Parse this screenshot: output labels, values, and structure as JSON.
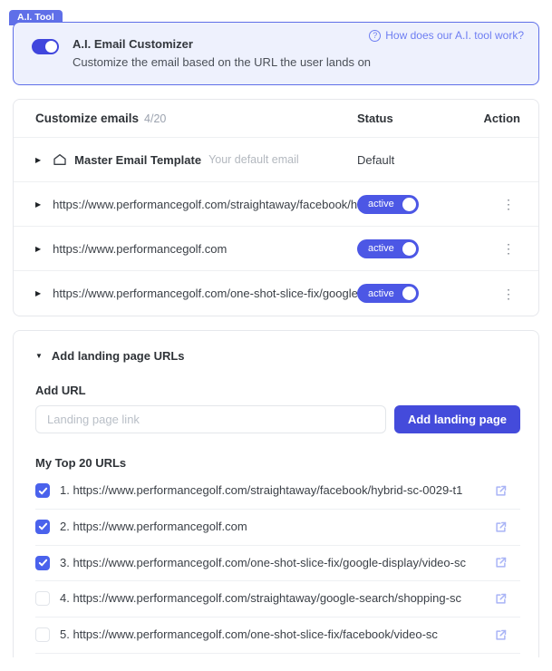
{
  "banner": {
    "badge": "A.I. Tool",
    "toggle_on": true,
    "title": "A.I. Email Customizer",
    "subtitle": "Customize the email based on the URL the user lands on",
    "help_icon": "?",
    "help_link": "How does our A.I. tool work?"
  },
  "table": {
    "title": "Customize emails",
    "count": "4/20",
    "columns": {
      "status": "Status",
      "action": "Action"
    },
    "master_row": {
      "label": "Master Email Template",
      "hint": "Your default email",
      "status": "Default"
    },
    "rows": [
      {
        "url": "https://www.performancegolf.com/straightaway/facebook/h",
        "status": "active"
      },
      {
        "url": "https://www.performancegolf.com",
        "status": "active"
      },
      {
        "url": "https://www.performancegolf.com/one-shot-slice-fix/google",
        "status": "active"
      }
    ]
  },
  "add_section": {
    "title": "Add landing page URLs",
    "add_url_label": "Add URL",
    "input_placeholder": "Landing page link",
    "button_label": "Add landing page",
    "list_title": "My Top 20 URLs",
    "urls": [
      {
        "text": "1. https://www.performancegolf.com/straightaway/facebook/hybrid-sc-0029-t1",
        "checked": true
      },
      {
        "text": "2. https://www.performancegolf.com",
        "checked": true
      },
      {
        "text": "3. https://www.performancegolf.com/one-shot-slice-fix/google-display/video-sc",
        "checked": true
      },
      {
        "text": "4. https://www.performancegolf.com/straightaway/google-search/shopping-sc",
        "checked": false
      },
      {
        "text": "5. https://www.performancegolf.com/one-shot-slice-fix/facebook/video-sc",
        "checked": false
      }
    ]
  },
  "icons": {
    "caret_right": "▶",
    "caret_down": "▼",
    "kebab": "⋮"
  },
  "colors": {
    "primary_blue": "#444bdb",
    "pill_blue": "#4c57e5",
    "badge_blue": "#5f6fe8",
    "link_blue": "#6e7ef2",
    "banner_bg": "#eef1fd",
    "checkbox_blue": "#4a62ec",
    "ext_icon_blue": "#a9b4f6"
  }
}
